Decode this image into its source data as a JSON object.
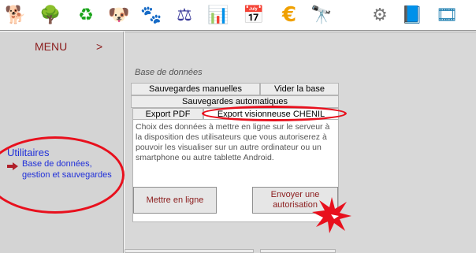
{
  "toolbar": {
    "icons": [
      {
        "name": "dog-icon",
        "glyph": "🐕"
      },
      {
        "name": "tree-icon",
        "glyph": "🌳"
      },
      {
        "name": "refresh-icon",
        "glyph": "♻"
      },
      {
        "name": "puppy-icon",
        "glyph": "🐶"
      },
      {
        "name": "dogs-group-icon",
        "glyph": "🐾"
      },
      {
        "name": "pedigree-icon",
        "glyph": "⚖"
      },
      {
        "name": "bar-chart-icon",
        "glyph": "📊"
      },
      {
        "name": "calendar-icon",
        "glyph": "📅"
      },
      {
        "name": "euro-icon",
        "glyph": "€"
      },
      {
        "name": "binoculars-icon",
        "glyph": "🔭"
      },
      {
        "name": "settings-icon",
        "glyph": "⚙"
      },
      {
        "name": "help-book-icon",
        "glyph": "📘"
      },
      {
        "name": "video-icon",
        "glyph": "🎞"
      }
    ]
  },
  "sidebar": {
    "menu_label": "MENU",
    "menu_arrow": ">",
    "section_title": "Utilitaires",
    "item_label": "Base de données, gestion et sauvegardes"
  },
  "main": {
    "section_title": "Base de données",
    "tabs": {
      "manual_backups": "Sauvegardes manuelles",
      "empty_db": "Vider la base",
      "auto_backups": "Sauvegardes automatiques",
      "export_pdf": "Export PDF",
      "export_viewer": "Export visionneuse CHENIL"
    },
    "panel_text": "Choix des données à mettre en ligne sur le serveur à la disposition des utilisateurs que vous autoriserez à pouvoir les visualiser sur un autre ordinateur ou un smartphone ou autre tablette Android.",
    "buttons": {
      "publish": "Mettre en ligne",
      "send_auth": "Envoyer une autorisation"
    }
  },
  "colors": {
    "annotation_red": "#e8101d",
    "link_blue": "#1f2fd9",
    "label_dark_red": "#8b1c1c"
  }
}
